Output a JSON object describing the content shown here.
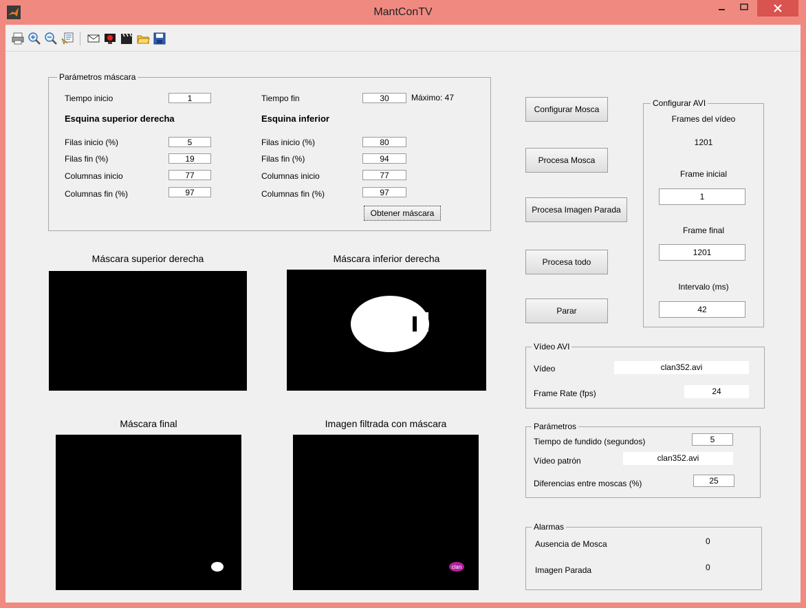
{
  "window": {
    "title": "MantConTV"
  },
  "mask_params": {
    "group_title": "Parámetros máscara",
    "tiempo_inicio_label": "Tiempo inicio",
    "tiempo_inicio": "1",
    "tiempo_fin_label": "Tiempo fin",
    "tiempo_fin": "30",
    "maximo": "Máximo: 47",
    "upper_heading": "Esquina superior derecha",
    "lower_heading": "Esquina inferior",
    "filas_inicio_label": "Filas inicio (%)",
    "filas_fin_label": "Filas fin (%)",
    "columnas_inicio_label": "Columnas inicio",
    "columnas_fin_label": "Columnas fin (%)",
    "upper": {
      "filas_inicio": "5",
      "filas_fin": "19",
      "columnas_inicio": "77",
      "columnas_fin": "97"
    },
    "lower": {
      "filas_inicio": "80",
      "filas_fin": "94",
      "columnas_inicio": "77",
      "columnas_fin": "97"
    },
    "obtener_label": "Obtener máscara"
  },
  "axes": {
    "upper_title": "Máscara superior derecha",
    "lower_title": "Máscara inferior derecha",
    "final_title": "Máscara final",
    "filtered_title": "Imagen filtrada con máscara",
    "logo_text": "clan"
  },
  "buttons": {
    "configurar_mosca": "Configurar Mosca",
    "procesa_mosca": "Procesa Mosca",
    "procesa_imagen_parada": "Procesa Imagen Parada",
    "procesa_todo": "Procesa todo",
    "parar": "Parar"
  },
  "config_avi": {
    "group_title": "Configurar AVI",
    "frames_label": "Frames del vídeo",
    "frames_value": "1201",
    "frame_inicial_label": "Frame inicial",
    "frame_inicial": "1",
    "frame_final_label": "Frame final",
    "frame_final": "1201",
    "intervalo_label": "Intervalo (ms)",
    "intervalo": "42"
  },
  "video_avi": {
    "group_title": "Vídeo AVI",
    "video_label": "Vídeo",
    "video_value": "clan352.avi",
    "fps_label": "Frame Rate (fps)",
    "fps_value": "24"
  },
  "parametros": {
    "group_title": "Parámetros",
    "fundido_label": "Tiempo de fundido (segundos)",
    "fundido_value": "5",
    "patron_label": "Vídeo patrón",
    "patron_value": "clan352.avi",
    "diferencias_label": "Diferencias entre moscas (%)",
    "diferencias_value": "25"
  },
  "alarmas": {
    "group_title": "Alarmas",
    "ausencia_label": "Ausencia de Mosca",
    "ausencia_value": "0",
    "parada_label": "Imagen Parada",
    "parada_value": "0"
  },
  "colors": {
    "titlebar": "#f08a80",
    "background": "#f0f0f0",
    "logo": "#b0209c"
  }
}
